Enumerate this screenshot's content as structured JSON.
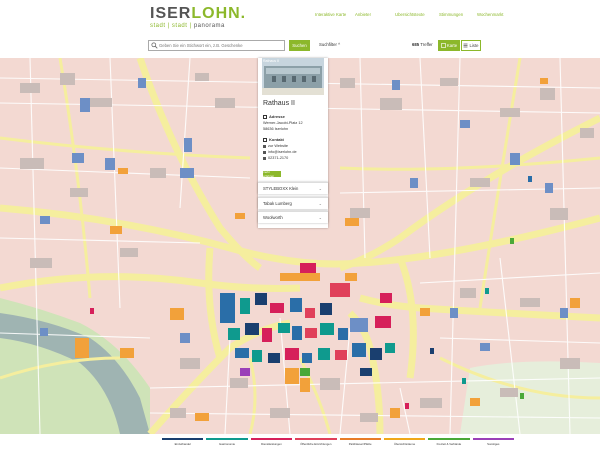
{
  "header": {
    "logo_main_a": "ISER",
    "logo_main_b": "LOHN",
    "logo_dot": ".",
    "logo_sub_a": "stadt",
    "logo_sub_sep1": " | ",
    "logo_sub_b": "stadt",
    "logo_sub_sep2": " | ",
    "logo_sub_c": "panorama",
    "nav": [
      "Interaktive Karte",
      "Anbieter",
      "Ubersichtstexte",
      "Stimmungen",
      "Wochenmarkt"
    ]
  },
  "search": {
    "placeholder": "Geben Sie ein Stichwort ein, z.B. Geschenke",
    "button": "Suchen",
    "filter": "Suchfilter ^",
    "results_count": "685",
    "results_label": "Treffer",
    "view_map": "Karte",
    "view_list": "Liste"
  },
  "popup": {
    "image_caption": "Rathaus II",
    "title": "Rathaus II",
    "address_heading": "Adresse",
    "address_line1": "Werner-Jacobi-Platz 12",
    "address_line2": "58636 Iserlohn",
    "contact_heading": "Kontakt",
    "website": "zur Website",
    "email": "info@iserlohn.de",
    "phone": "02371-2170",
    "more_button": "mehr erfahren"
  },
  "accordion": [
    "STYLEBOXX Klein",
    "Tabak Lumberg",
    "Woolworth"
  ],
  "legend": [
    {
      "label": "Einzelhandel",
      "color": "#1a3f6f"
    },
    {
      "label": "Gastronomie",
      "color": "#0f9a8e"
    },
    {
      "label": "Dienstleistungen",
      "color": "#d6205a"
    },
    {
      "label": "Öffentliche Einrichtungen",
      "color": "#e0405a"
    },
    {
      "label": "Parkhäuser/Plätze",
      "color": "#e87c28"
    },
    {
      "label": "Übersichtsräume",
      "color": "#f0a81a"
    },
    {
      "label": "Freizeit & Verbände",
      "color": "#4aa838"
    },
    {
      "label": "Sonstiges",
      "color": "#9a3fb8"
    }
  ]
}
